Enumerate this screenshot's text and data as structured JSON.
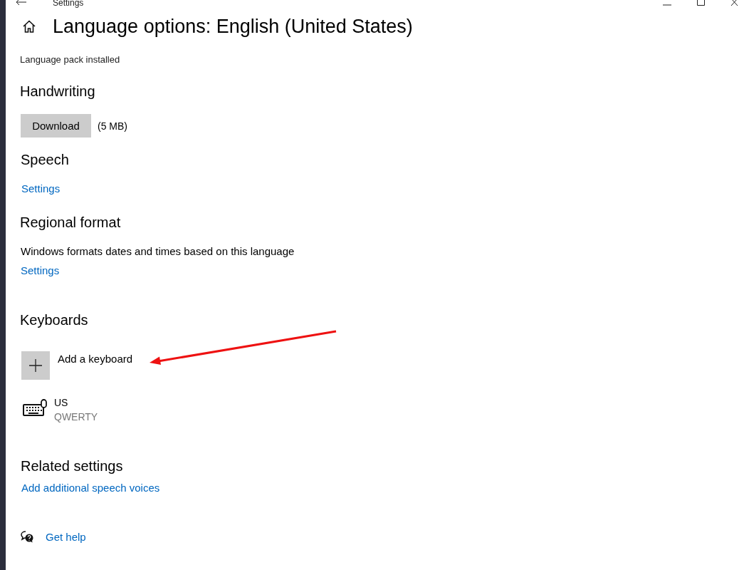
{
  "window": {
    "title": "Settings"
  },
  "page_title": "Language options: English (United States)",
  "status": "Language pack installed",
  "sections": [
    {
      "kind": "download",
      "heading": "Handwriting",
      "button": "Download",
      "size": "(5 MB)"
    },
    {
      "kind": "link",
      "heading": "Speech",
      "link": "Settings"
    },
    {
      "kind": "text-link",
      "heading": "Regional format",
      "text": "Windows formats dates and times based on this language",
      "link": "Settings"
    },
    {
      "kind": "keyboards",
      "heading": "Keyboards",
      "add_label": "Add a keyboard",
      "keyboards": [
        {
          "name": "US",
          "layout": "QWERTY"
        }
      ]
    },
    {
      "kind": "link",
      "heading": "Related settings",
      "link": "Add additional speech voices"
    }
  ],
  "help": {
    "link": "Get help"
  }
}
